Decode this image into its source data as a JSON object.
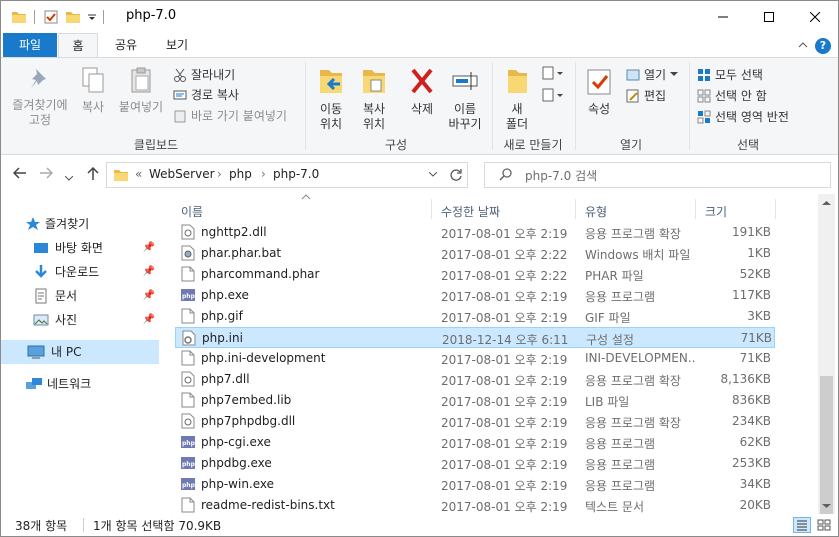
{
  "window": {
    "title": "php-7.0"
  },
  "ribbon_tabs": [
    "파일",
    "홈",
    "공유",
    "보기"
  ],
  "ribbon": {
    "clipboard": {
      "pin_label": "즐겨찾기에\n고정",
      "copy_label": "복사",
      "paste_label": "붙여넣기",
      "cut_label": "잘라내기",
      "copy_path_label": "경로 복사",
      "paste_shortcut_label": "바로 가기 붙여넣기",
      "group": "클립보드"
    },
    "organize": {
      "move_label": "이동\n위치",
      "copy_to_label": "복사\n위치",
      "delete_label": "삭제",
      "rename_label": "이름\n바꾸기",
      "group": "구성"
    },
    "new": {
      "new_folder_label": "새\n폴더",
      "group": "새로 만들기"
    },
    "open": {
      "properties_label": "속성",
      "open_label": "열기",
      "edit_label": "편집",
      "group": "열기"
    },
    "select": {
      "select_all": "모두 선택",
      "select_none": "선택 안 함",
      "invert": "선택 영역 반전",
      "group": "선택"
    }
  },
  "address": {
    "prefix": "«",
    "crumbs": [
      "WebServer",
      "php",
      "php-7.0"
    ],
    "search_placeholder": "php-7.0 검색"
  },
  "nav_pane": {
    "quick_access": "즐겨찾기",
    "items": [
      "바탕 화면",
      "다운로드",
      "문서",
      "사진"
    ],
    "this_pc": "내 PC",
    "network": "네트워크"
  },
  "columns": {
    "name": "이름",
    "date": "수정한 날짜",
    "type": "유형",
    "size": "크기"
  },
  "files": [
    {
      "name": "nghttp2.dll",
      "date": "2017-08-01 오후 2:19",
      "type": "응용 프로그램 확장",
      "size": "191KB",
      "icon": "dll"
    },
    {
      "name": "phar.phar.bat",
      "date": "2017-08-01 오후 2:22",
      "type": "Windows 배치 파일",
      "size": "1KB",
      "icon": "bat"
    },
    {
      "name": "pharcommand.phar",
      "date": "2017-08-01 오후 2:22",
      "type": "PHAR 파일",
      "size": "52KB",
      "icon": "file"
    },
    {
      "name": "php.exe",
      "date": "2017-08-01 오후 2:19",
      "type": "응용 프로그램",
      "size": "117KB",
      "icon": "php"
    },
    {
      "name": "php.gif",
      "date": "2017-08-01 오후 2:19",
      "type": "GIF 파일",
      "size": "3KB",
      "icon": "file"
    },
    {
      "name": "php.ini",
      "date": "2018-12-14 오후 6:11",
      "type": "구성 설정",
      "size": "71KB",
      "icon": "ini",
      "selected": true
    },
    {
      "name": "php.ini-development",
      "date": "2017-08-01 오후 2:19",
      "type": "INI-DEVELOPMEN...",
      "size": "71KB",
      "icon": "file"
    },
    {
      "name": "php7.dll",
      "date": "2017-08-01 오후 2:19",
      "type": "응용 프로그램 확장",
      "size": "8,136KB",
      "icon": "dll"
    },
    {
      "name": "php7embed.lib",
      "date": "2017-08-01 오후 2:19",
      "type": "LIB 파일",
      "size": "836KB",
      "icon": "file"
    },
    {
      "name": "php7phpdbg.dll",
      "date": "2017-08-01 오후 2:19",
      "type": "응용 프로그램 확장",
      "size": "234KB",
      "icon": "dll"
    },
    {
      "name": "php-cgi.exe",
      "date": "2017-08-01 오후 2:19",
      "type": "응용 프로그램",
      "size": "62KB",
      "icon": "php"
    },
    {
      "name": "phpdbg.exe",
      "date": "2017-08-01 오후 2:19",
      "type": "응용 프로그램",
      "size": "253KB",
      "icon": "php"
    },
    {
      "name": "php-win.exe",
      "date": "2017-08-01 오후 2:19",
      "type": "응용 프로그램",
      "size": "34KB",
      "icon": "php"
    },
    {
      "name": "readme-redist-bins.txt",
      "date": "2017-08-01 오후 2:19",
      "type": "텍스트 문서",
      "size": "20KB",
      "icon": "file"
    }
  ],
  "status": {
    "count": "38개 항목",
    "selection": "1개 항목 선택함 70.9KB"
  },
  "colors": {
    "accent": "#1979ca",
    "selection": "#cce8ff",
    "selection_border": "#99d1ff"
  }
}
